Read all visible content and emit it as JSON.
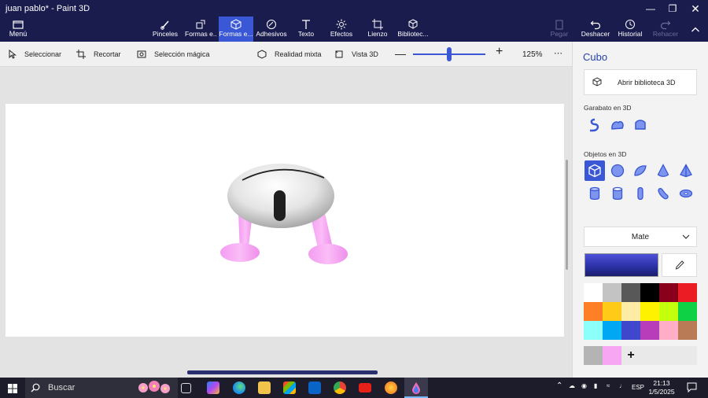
{
  "window": {
    "title": "juan pablo* - Paint 3D"
  },
  "header": {
    "menu_label": "Menú",
    "tools": [
      {
        "label": "Pinceles",
        "icon": "brush-icon"
      },
      {
        "label": "Formas e...",
        "icon": "shapes-2d-icon"
      },
      {
        "label": "Formas e...",
        "icon": "shapes-3d-icon",
        "active": true
      },
      {
        "label": "Adhesivos",
        "icon": "sticker-icon"
      },
      {
        "label": "Texto",
        "icon": "text-icon"
      },
      {
        "label": "Efectos",
        "icon": "effects-icon"
      },
      {
        "label": "Lienzo",
        "icon": "canvas-icon"
      },
      {
        "label": "Bibliotec...",
        "icon": "library-icon"
      }
    ],
    "right_tools": [
      {
        "label": "Pegar",
        "icon": "paste-icon",
        "disabled": true
      },
      {
        "label": "Deshacer",
        "icon": "undo-icon"
      },
      {
        "label": "Historial",
        "icon": "history-icon"
      },
      {
        "label": "Rehacer",
        "icon": "redo-icon",
        "disabled": true
      }
    ]
  },
  "toolbar2": {
    "select_label": "Seleccionar",
    "crop_label": "Recortar",
    "magic_select_label": "Selección mágica",
    "mixed_reality_label": "Realidad mixta",
    "view3d_label": "Vista 3D",
    "zoom_label": "125%",
    "zoom_level": 0.5
  },
  "panel": {
    "title": "Cubo",
    "library_button": "Abrir biblioteca 3D",
    "doodle_section": "Garabato en 3D",
    "objects_section": "Objetos en 3D",
    "material": "Mate",
    "current_color": "#3a3fc0",
    "palette": [
      "#ffffff",
      "#c3c3c3",
      "#585858",
      "#000000",
      "#88001b",
      "#ec1c24",
      "#ff7f27",
      "#ffca18",
      "#fdeca6",
      "#fff200",
      "#c4ff0e",
      "#0ed145",
      "#8cfffb",
      "#00a8f3",
      "#3f48cc",
      "#b83dba",
      "#ffaec8",
      "#b97a56"
    ],
    "custom_colors": [
      "#b4b4b4",
      "#f7a6f4"
    ]
  },
  "taskbar": {
    "search_label": "Buscar",
    "language": "ESP",
    "time": "21:13",
    "date": "1/5/2025"
  }
}
